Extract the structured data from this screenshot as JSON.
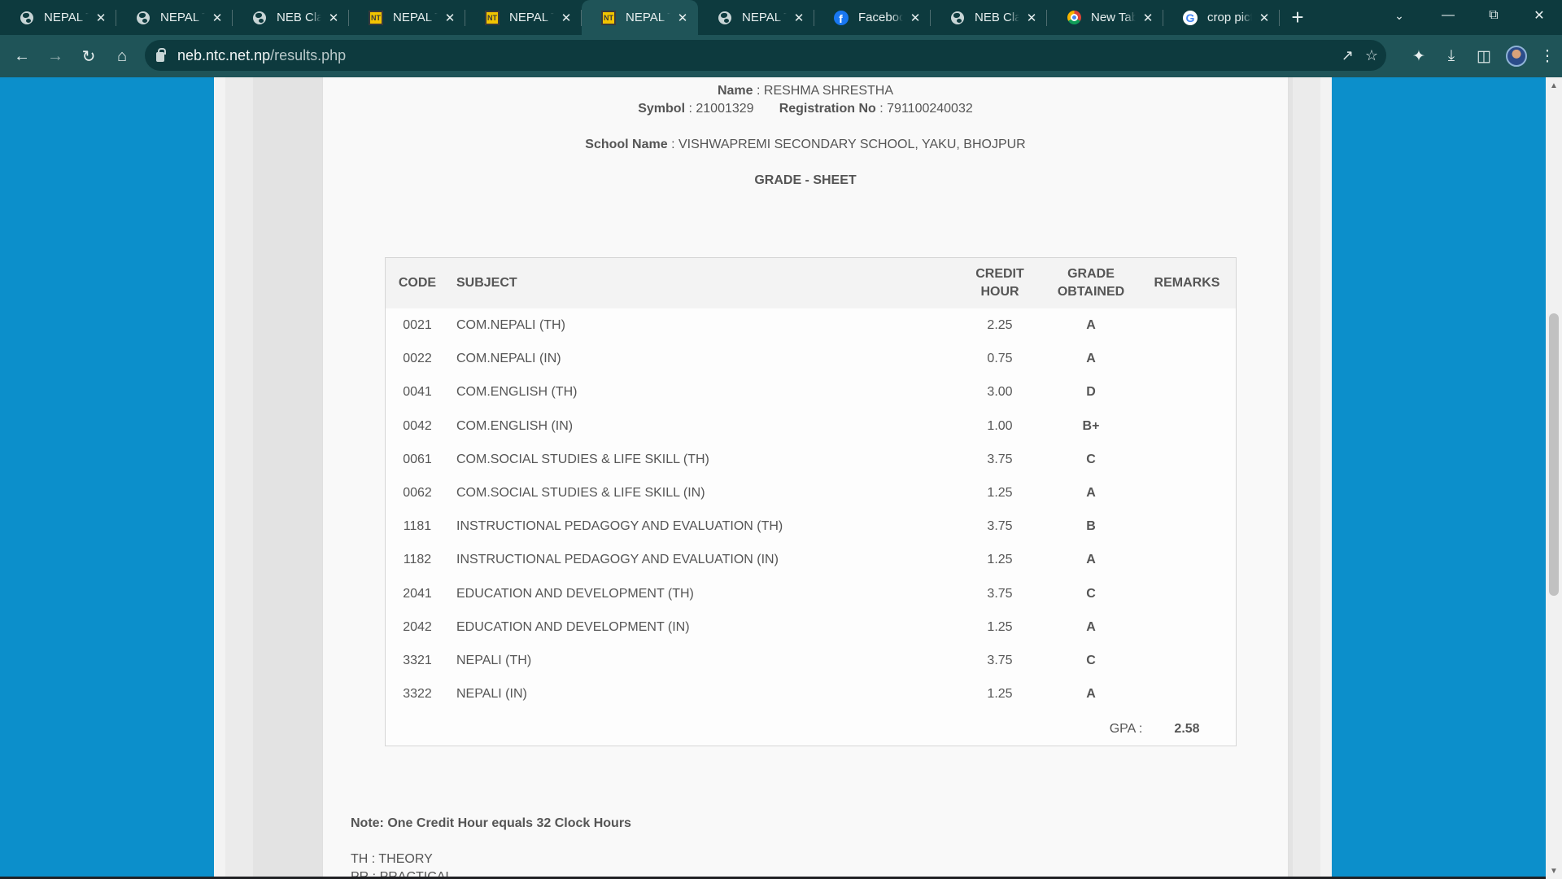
{
  "tabs": [
    {
      "title": "NEPAL TE",
      "icon": "globe-icon",
      "fav": "globe"
    },
    {
      "title": "NEPAL TE",
      "icon": "globe-icon",
      "fav": "globe"
    },
    {
      "title": "NEB Class",
      "icon": "globe-icon",
      "fav": "globe"
    },
    {
      "title": "NEPAL TE",
      "icon": "nt-logo-icon",
      "fav": "nt"
    },
    {
      "title": "NEPAL TE",
      "icon": "nt-logo-icon",
      "fav": "nt"
    },
    {
      "title": "NEPAL TE",
      "icon": "nt-logo-icon",
      "fav": "nt",
      "active": true
    },
    {
      "title": "NEPAL TE",
      "icon": "globe-icon",
      "fav": "globe"
    },
    {
      "title": "Facebook",
      "icon": "facebook-icon",
      "fav": "fb"
    },
    {
      "title": "NEB Class",
      "icon": "globe-icon",
      "fav": "globe"
    },
    {
      "title": "New Tab",
      "icon": "chrome-icon",
      "fav": "chrome"
    },
    {
      "title": "crop pictu",
      "icon": "google-icon",
      "fav": "google"
    }
  ],
  "address_bar": {
    "host": "neb.ntc.net.np",
    "path": "/results.php"
  },
  "student": {
    "name_label": "Name",
    "name": "RESHMA SHRESTHA",
    "symbol_label": "Symbol",
    "symbol": "21001329",
    "registration_label": "Registration No",
    "registration": "791100240032",
    "school_label": "School Name",
    "school": "VISHWAPREMI SECONDARY SCHOOL, YAKU, BHOJPUR",
    "sheet_title": "GRADE - SHEET"
  },
  "table": {
    "headers": {
      "code": "CODE",
      "subject": "SUBJECT",
      "credit_1": "CREDIT",
      "credit_2": "HOUR",
      "grade_1": "GRADE",
      "grade_2": "OBTAINED",
      "remarks": "REMARKS"
    },
    "rows": [
      {
        "code": "0021",
        "subject": "COM.NEPALI (TH)",
        "credit": "2.25",
        "grade": "A"
      },
      {
        "code": "0022",
        "subject": "COM.NEPALI (IN)",
        "credit": "0.75",
        "grade": "A"
      },
      {
        "code": "0041",
        "subject": "COM.ENGLISH (TH)",
        "credit": "3.00",
        "grade": "D"
      },
      {
        "code": "0042",
        "subject": "COM.ENGLISH (IN)",
        "credit": "1.00",
        "grade": "B+"
      },
      {
        "code": "0061",
        "subject": "COM.SOCIAL STUDIES & LIFE SKILL (TH)",
        "credit": "3.75",
        "grade": "C"
      },
      {
        "code": "0062",
        "subject": "COM.SOCIAL STUDIES & LIFE SKILL (IN)",
        "credit": "1.25",
        "grade": "A"
      },
      {
        "code": "1181",
        "subject": "INSTRUCTIONAL PEDAGOGY AND EVALUATION (TH)",
        "credit": "3.75",
        "grade": "B"
      },
      {
        "code": "1182",
        "subject": "INSTRUCTIONAL PEDAGOGY AND EVALUATION (IN)",
        "credit": "1.25",
        "grade": "A"
      },
      {
        "code": "2041",
        "subject": "EDUCATION AND DEVELOPMENT (TH)",
        "credit": "3.75",
        "grade": "C"
      },
      {
        "code": "2042",
        "subject": "EDUCATION AND DEVELOPMENT (IN)",
        "credit": "1.25",
        "grade": "A"
      },
      {
        "code": "3321",
        "subject": "NEPALI (TH)",
        "credit": "3.75",
        "grade": "C"
      },
      {
        "code": "3322",
        "subject": "NEPALI (IN)",
        "credit": "1.25",
        "grade": "A"
      }
    ],
    "gpa_label": "GPA :",
    "gpa": "2.58"
  },
  "notes": {
    "credit_note": "Note: One Credit Hour equals 32 Clock Hours",
    "legend_th": "TH : THEORY",
    "legend_pr": "PR : PRACTICAL"
  },
  "colors": {
    "page_background": "#0c8fcb",
    "tab_strip": "#0d3a3e",
    "toolbar": "#1f5458"
  }
}
